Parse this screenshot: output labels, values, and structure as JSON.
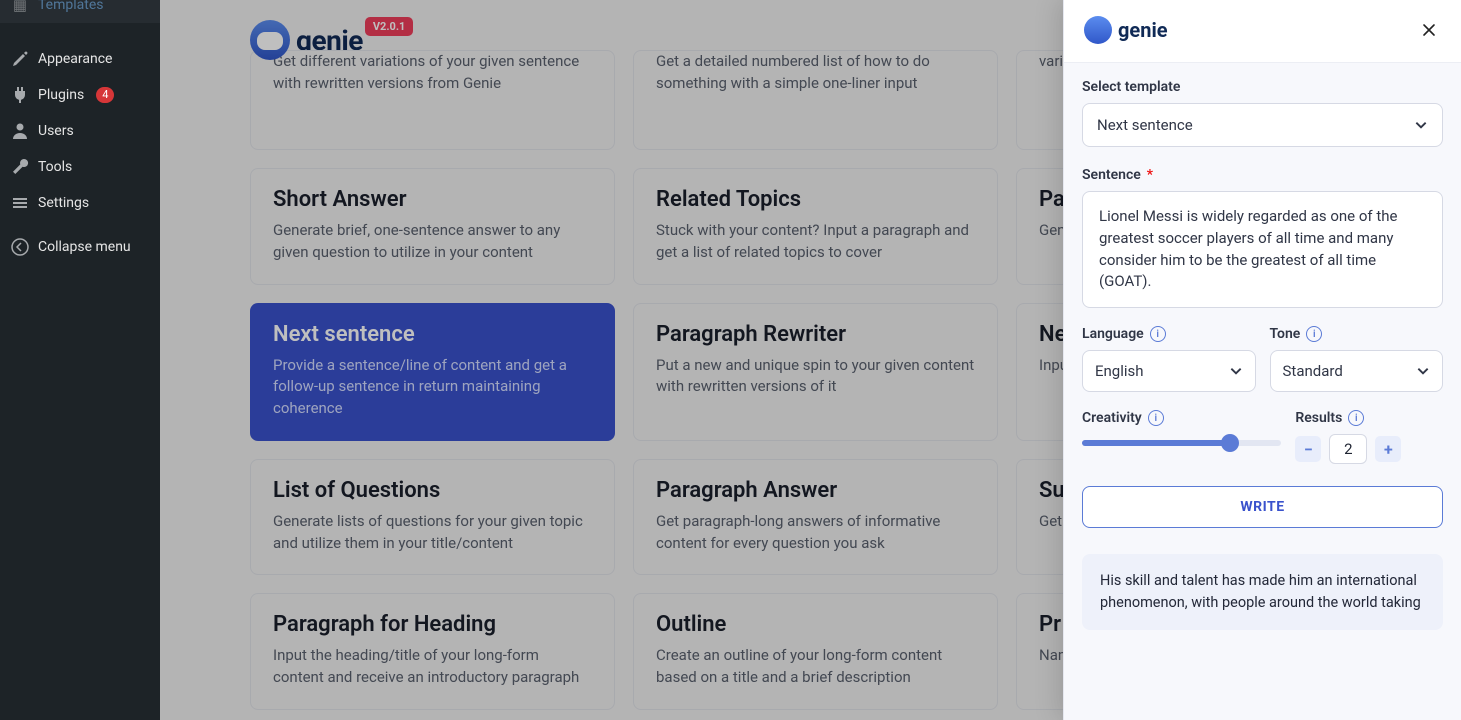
{
  "sidebar": {
    "items": [
      {
        "label": "Templates",
        "icon": "grid"
      },
      {
        "label": "Appearance",
        "icon": "brush"
      },
      {
        "label": "Plugins",
        "icon": "plug",
        "badge": "4"
      },
      {
        "label": "Users",
        "icon": "user"
      },
      {
        "label": "Tools",
        "icon": "wrench"
      },
      {
        "label": "Settings",
        "icon": "sliders"
      },
      {
        "label": "Collapse menu",
        "icon": "collapse"
      }
    ]
  },
  "logo_text": "genie",
  "version": "V2.0.1",
  "cards": [
    {
      "title": "",
      "desc": "Get different variations of your given sentence with rewritten versions from Genie",
      "cut": true
    },
    {
      "title": "",
      "desc": "Get a detailed numbered list of how to do something with a simple one-liner input",
      "cut": true
    },
    {
      "title": "",
      "desc": "varia",
      "cut": true
    },
    {
      "title": "Short Answer",
      "desc": "Generate brief, one-sentence answer to any given question to utilize in your content"
    },
    {
      "title": "Related Topics",
      "desc": "Stuck with your content? Input a paragraph and get a list of related topics to cover"
    },
    {
      "title": "Pa",
      "desc": "Gen\nthe"
    },
    {
      "title": "Next sentence",
      "desc": "Provide a sentence/line of content and get a follow-up sentence in return maintaining coherence",
      "active": true
    },
    {
      "title": "Paragraph Rewriter",
      "desc": "Put a new and unique spin to your given content with rewritten versions of it"
    },
    {
      "title": "Ne",
      "desc": "Inpu\ncont"
    },
    {
      "title": "List of Questions",
      "desc": "Generate lists of questions for your given topic and utilize them in your title/content"
    },
    {
      "title": "Paragraph Answer",
      "desc": "Get paragraph-long answers of informative content for every question you ask"
    },
    {
      "title": "Su",
      "desc": "Get\nwith"
    },
    {
      "title": "Paragraph for Heading",
      "desc": "Input the heading/title of your long-form content and receive an introductory paragraph"
    },
    {
      "title": "Outline",
      "desc": "Create an outline of your long-form content based on a title and a brief description"
    },
    {
      "title": "Pr",
      "desc": "Nam\nwrit"
    }
  ],
  "panel": {
    "select_template_label": "Select template",
    "template_value": "Next sentence",
    "sentence_label": "Sentence",
    "sentence_value": "Lionel Messi is widely regarded as one of the greatest soccer players of all time and many consider him to be the greatest of all time (GOAT).",
    "language_label": "Language",
    "language_value": "English",
    "tone_label": "Tone",
    "tone_value": "Standard",
    "creativity_label": "Creativity",
    "results_label": "Results",
    "results_value": "2",
    "write_label": "WRITE",
    "result_text": "His skill and talent has made him an international phenomenon, with people around the world taking"
  }
}
